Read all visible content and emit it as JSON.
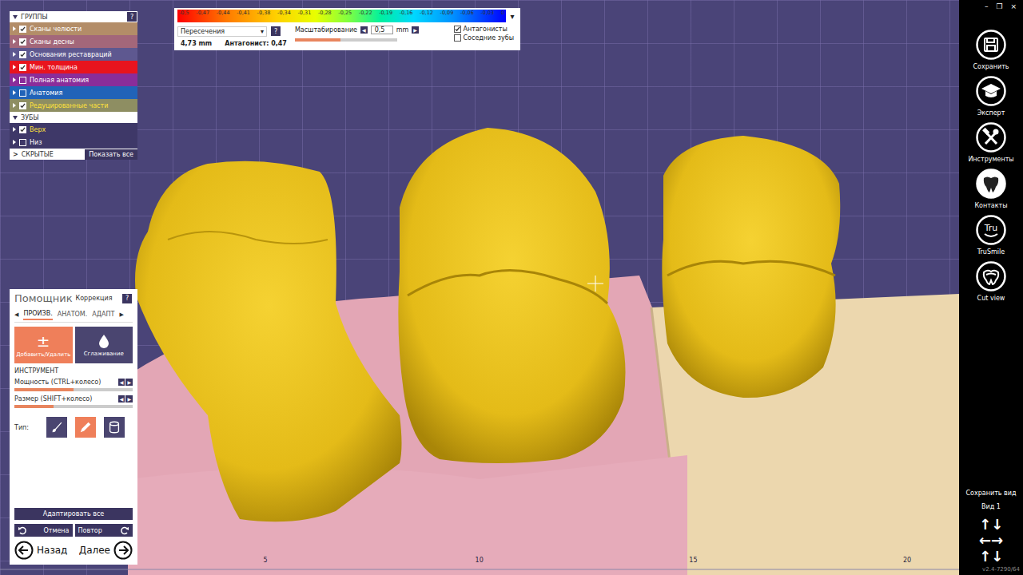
{
  "window": {
    "controls": [
      "–",
      "❐",
      "×"
    ],
    "version": "v2.4-7290/64"
  },
  "groups_panel": {
    "title": "ГРУППЫ",
    "help": "?",
    "items": [
      {
        "label": "Сканы челюсти",
        "checked": true,
        "highlighted": false,
        "color": "#b38d68"
      },
      {
        "label": "Сканы десны",
        "checked": true,
        "highlighted": false,
        "color": "#a3677a"
      },
      {
        "label": "Основания реставраций",
        "checked": true,
        "highlighted": false,
        "color": "#5e5890"
      },
      {
        "label": "Мин. толщина",
        "checked": true,
        "highlighted": false,
        "color": "#e8141e"
      },
      {
        "label": "Полная анатомия",
        "checked": false,
        "highlighted": false,
        "color": "#8a2d9a"
      },
      {
        "label": "Анатомия",
        "checked": false,
        "highlighted": false,
        "color": "#2163b8"
      },
      {
        "label": "Редуцированные части",
        "checked": true,
        "highlighted": true,
        "color": "#8e8e62"
      }
    ]
  },
  "teeth_panel": {
    "title": "ЗУБЫ",
    "items": [
      {
        "label": "Верх",
        "checked": true,
        "highlighted": true
      },
      {
        "label": "Низ",
        "checked": false,
        "highlighted": false
      }
    ]
  },
  "hidden_row": {
    "arrow": ">",
    "label": "СКРЫТЫЕ",
    "button": "Показать все"
  },
  "distance_panel": {
    "scale_labels": [
      "-0,5",
      "-0,47",
      "-0,44",
      "-0,41",
      "-0,38",
      "-0,34",
      "-0,31",
      "-0,28",
      "-0,25",
      "-0,22",
      "-0,19",
      "-0,16",
      "-0,12",
      "-0,09",
      "-0,06",
      "-0,03",
      "0"
    ],
    "collapse": "▾",
    "mode": "Пересечения",
    "mode_arrow": "▾",
    "help": "?",
    "scaling_label": "Масштабирование",
    "arrows": [
      "◀",
      "▶"
    ],
    "scaling_value": "0,5",
    "unit": "mm",
    "scaling_level": 0.45,
    "measure": "4,73 mm",
    "antagonist": "Антагонист: 0,47",
    "options": [
      {
        "label": "Антагонисты",
        "checked": true
      },
      {
        "label": "Соседние зубы",
        "checked": false
      }
    ]
  },
  "assistant": {
    "title": "Помощник",
    "subtitle": "Коррекция",
    "help": "?",
    "arrows": [
      "◀",
      "▶"
    ],
    "tabs": [
      {
        "label": "ПРОИЗВ.",
        "selected": true
      },
      {
        "label": "АНАТОМ.",
        "selected": false
      },
      {
        "label": "АДАПТ",
        "selected": false
      }
    ],
    "tools": [
      {
        "label": "Добавить/Удалить",
        "kind": "plusminus",
        "glyph": "±",
        "selected": true
      },
      {
        "label": "Сглаживание",
        "kind": "drop",
        "selected": false
      }
    ],
    "section": "ИНСТРУМЕНТ",
    "sliders": [
      {
        "label": "Мощность (CTRL+колесо)",
        "level": 0.5
      },
      {
        "label": "Размер (SHIFT+колесо)",
        "level": 0.33
      }
    ],
    "type_label": "Тип:",
    "types": [
      {
        "kind": "brush",
        "selected": false
      },
      {
        "kind": "pen",
        "selected": true
      },
      {
        "kind": "cylinder",
        "selected": false
      }
    ],
    "adapt_all": "Адаптировать все",
    "undo": "Отмена",
    "redo": "Повтор",
    "back": "Назад",
    "next": "Далее"
  },
  "sidebar": {
    "items": [
      {
        "label": "Сохранить",
        "kind": "save",
        "selected": false
      },
      {
        "label": "Эксперт",
        "kind": "expert",
        "selected": false
      },
      {
        "label": "Инструменты",
        "kind": "tools",
        "selected": false
      },
      {
        "label": "Контакты",
        "kind": "contacts",
        "selected": true
      },
      {
        "label": "TruSmile",
        "kind": "trusmile",
        "badge": "Tru",
        "selected": false
      },
      {
        "label": "Cut view",
        "kind": "cutview",
        "selected": false
      }
    ],
    "save_view": "Сохранить вид",
    "view_name": "Вид 1",
    "nav": [
      "↑↓",
      "←→",
      "↑↓"
    ]
  },
  "ruler": [
    "5",
    "10",
    "15",
    "20"
  ]
}
